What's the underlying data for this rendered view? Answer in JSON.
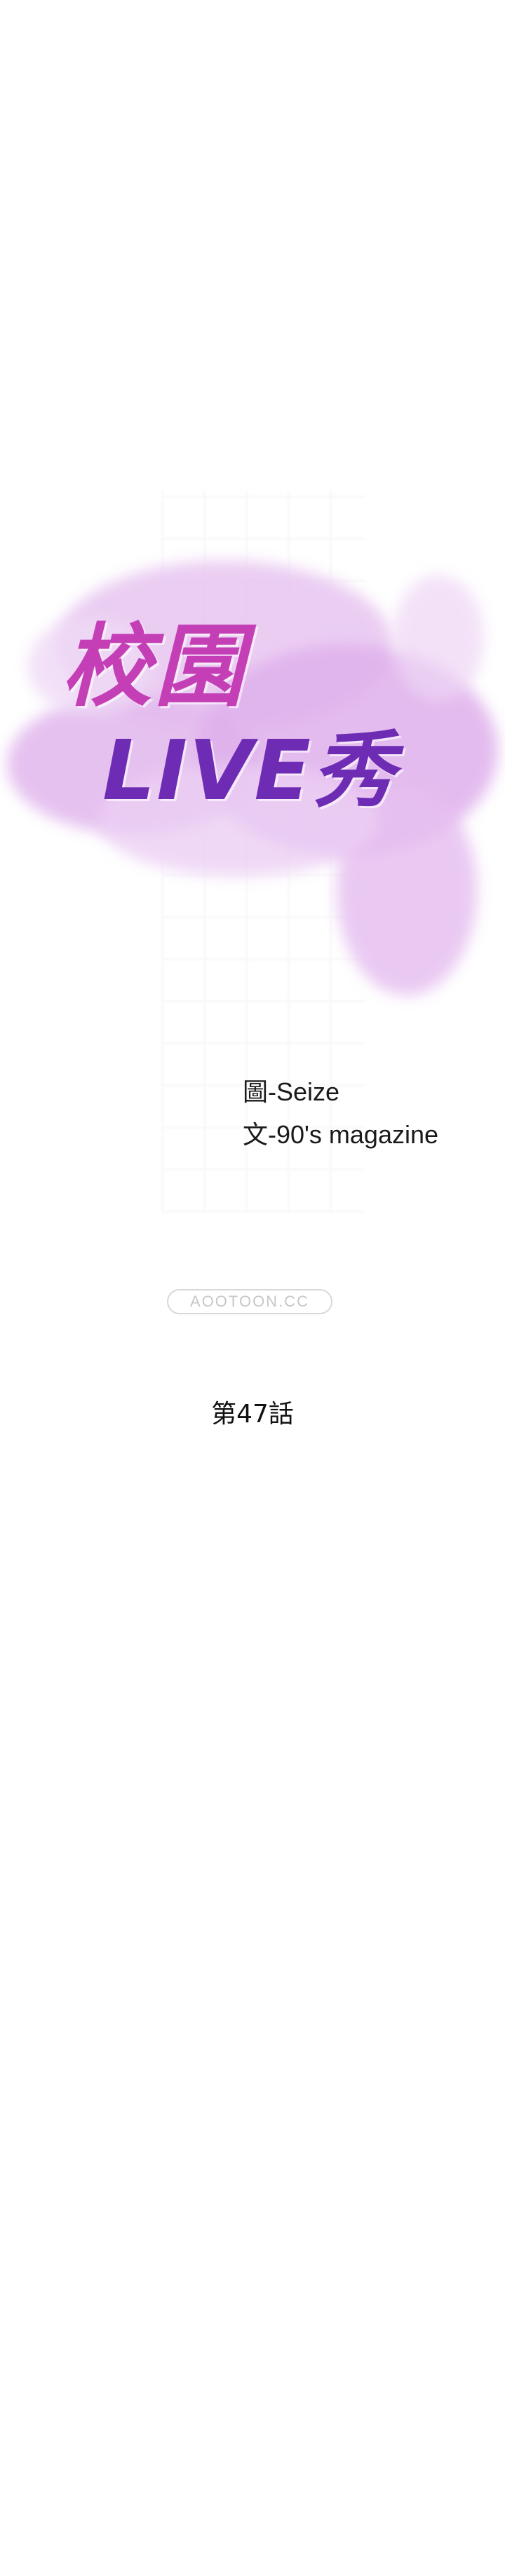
{
  "cover": {
    "title_line1": "校園",
    "title_line2": "LIVE秀",
    "credit_art": "圖-Seize",
    "credit_story": "文-90's magazine",
    "site_watermark": "AOOTOON.CC",
    "chapter": "第47話"
  },
  "colors": {
    "background": "#ffffff",
    "title_pink": "#c43fb6",
    "title_purple": "#6d2cb3",
    "cloud_lavender": "#e3bbee"
  }
}
